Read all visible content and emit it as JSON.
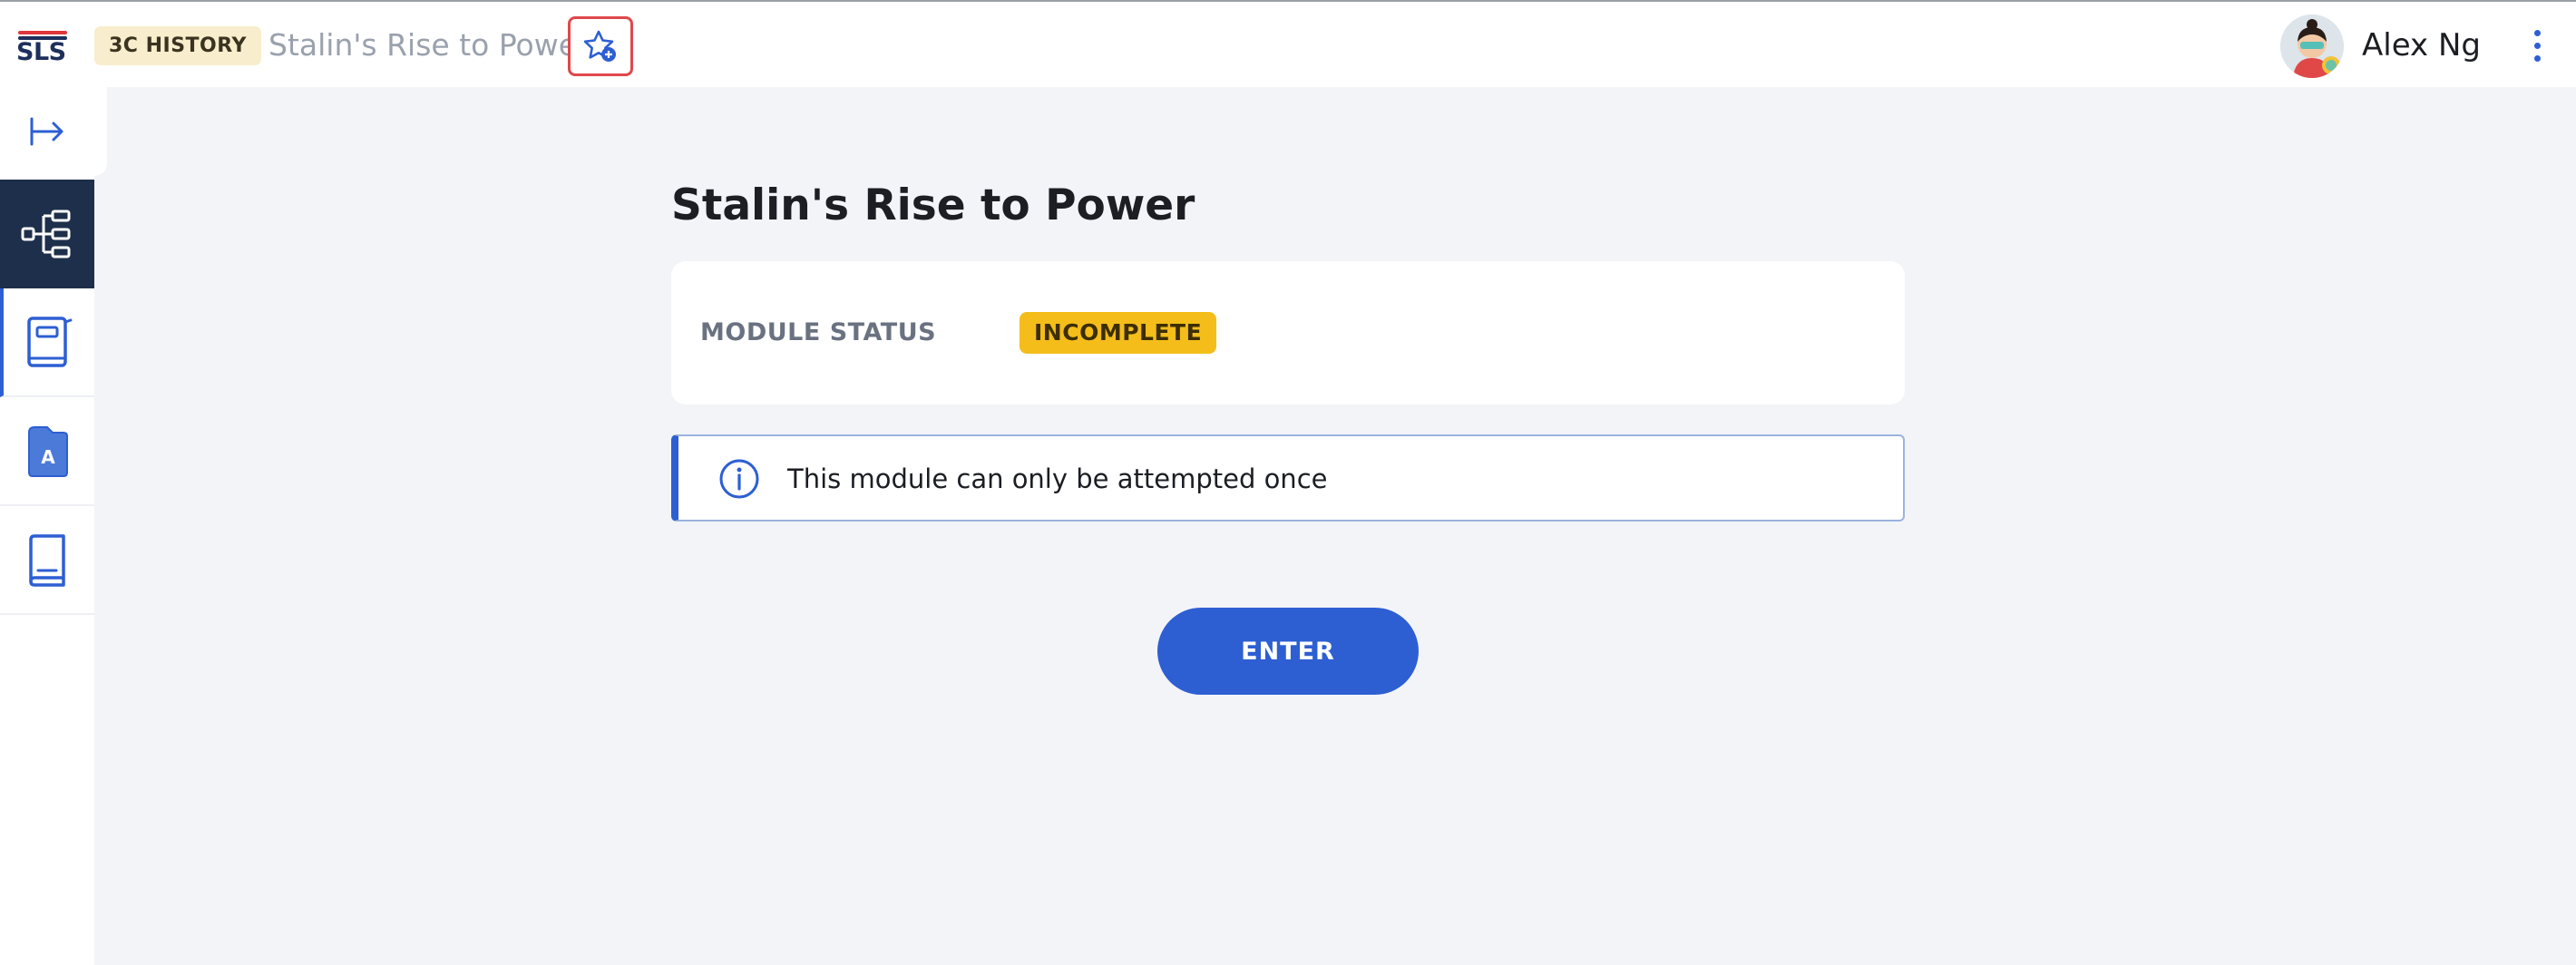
{
  "header": {
    "logo_text": "SLS",
    "subject_badge": "3C HISTORY",
    "page_crumb": "Stalin's Rise to Power",
    "favourite_icon": "star-add-icon",
    "user_name": "Alex Ng",
    "menu_icon": "kebab-menu-icon"
  },
  "sidebar": {
    "items": [
      {
        "icon": "expand-arrow-icon"
      },
      {
        "icon": "tree-structure-icon"
      },
      {
        "icon": "notebook-icon"
      },
      {
        "icon": "assessment-icon"
      },
      {
        "icon": "book-icon"
      }
    ]
  },
  "main": {
    "title": "Stalin's Rise to Power",
    "status_label": "MODULE STATUS",
    "status_value": "INCOMPLETE",
    "info_text": "This module can only be attempted once",
    "enter_label": "ENTER"
  },
  "colors": {
    "accent": "#2d5fd3",
    "sidebar_active": "#1d2f4a",
    "status_badge": "#f4bd1a",
    "subject_badge": "#f8edcc",
    "favourite_outline": "#e0484c"
  }
}
